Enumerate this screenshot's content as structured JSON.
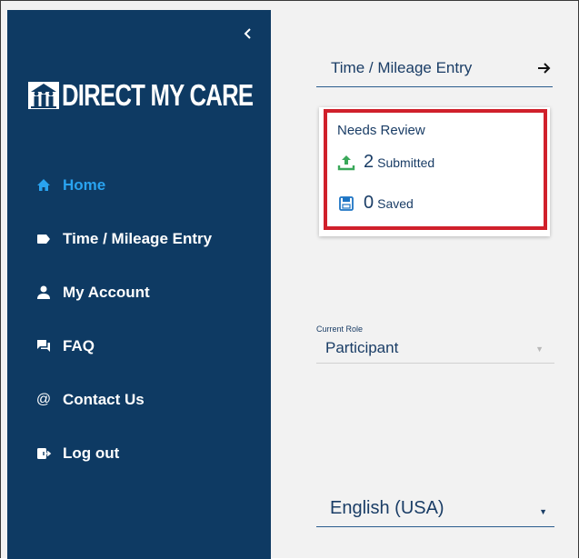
{
  "sidebar": {
    "logo_text": "DIRECT MY CARE",
    "nav": [
      {
        "label": "Home",
        "icon": "home-icon",
        "active": true
      },
      {
        "label": "Time / Mileage Entry",
        "icon": "tag-icon",
        "active": false
      },
      {
        "label": "My Account",
        "icon": "person-icon",
        "active": false
      },
      {
        "label": "FAQ",
        "icon": "chat-icon",
        "active": false
      },
      {
        "label": "Contact Us",
        "icon": "at-icon",
        "active": false
      },
      {
        "label": "Log out",
        "icon": "logout-icon",
        "active": false
      }
    ]
  },
  "main": {
    "entry_link": "Time / Mileage Entry",
    "review": {
      "title": "Needs Review",
      "submitted_count": "2",
      "submitted_label": "Submitted",
      "saved_count": "0",
      "saved_label": "Saved"
    },
    "role": {
      "caption": "Current Role",
      "value": "Participant"
    },
    "language": {
      "value": "English (USA)"
    }
  },
  "colors": {
    "sidebar_bg": "#0e3a63",
    "active_nav": "#29a3f0",
    "text_primary": "#1a3d66",
    "highlight": "#d0202b",
    "upload_green": "#3aa85a"
  }
}
